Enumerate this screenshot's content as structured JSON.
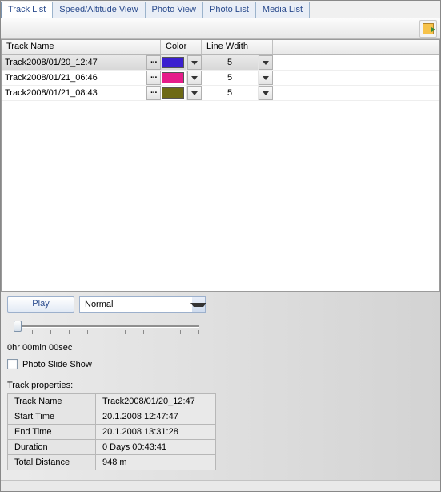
{
  "tabs": [
    "Track List",
    "Speed/Altitude View",
    "Photo View",
    "Photo List",
    "Media List"
  ],
  "active_tab": 0,
  "grid": {
    "headers": {
      "name": "Track Name",
      "color": "Color",
      "line": "Line Wdith"
    },
    "rows": [
      {
        "name": "Track2008/01/20_12:47",
        "color": "#3b1fcf",
        "line": "5",
        "selected": true
      },
      {
        "name": "Track2008/01/21_06:46",
        "color": "#e61c8a",
        "line": "5",
        "selected": false
      },
      {
        "name": "Track2008/01/21_08:43",
        "color": "#6e6a15",
        "line": "5",
        "selected": false
      }
    ]
  },
  "play": {
    "button": "Play",
    "speed": "Normal"
  },
  "time_label": "0hr 00min 00sec",
  "slide_checkbox_label": "Photo Slide Show",
  "props_title": "Track properties:",
  "props": {
    "rows": [
      {
        "k": "Track Name",
        "v": "Track2008/01/20_12:47"
      },
      {
        "k": "Start Time",
        "v": "20.1.2008 12:47:47"
      },
      {
        "k": "End Time",
        "v": "20.1.2008 13:31:28"
      },
      {
        "k": "Duration",
        "v": "0 Days  00:43:41"
      },
      {
        "k": "Total Distance",
        "v": "948 m"
      }
    ]
  }
}
